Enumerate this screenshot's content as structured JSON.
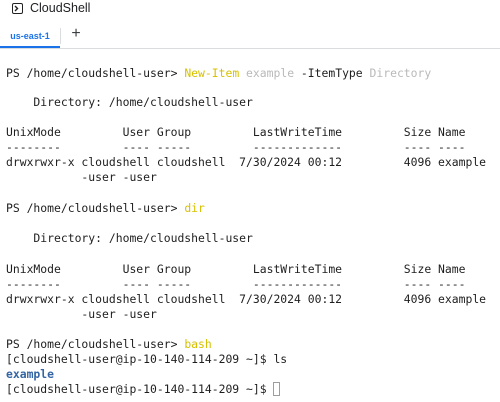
{
  "window": {
    "title": "CloudShell",
    "icon": "terminal-icon"
  },
  "tabs": [
    {
      "label": "us-east-1",
      "active": true
    }
  ],
  "add_tab_label": "+",
  "colors": {
    "accent": "#1a73e8",
    "command": "#d7c100",
    "argument_dim": "#b9b9b9",
    "directory": "#3465a4"
  },
  "terminal": {
    "prompt": "PS /home/cloudshell-user> ",
    "cmd1": {
      "name": "New-Item",
      "arg": "example",
      "param": "-ItemType",
      "value": "Directory"
    },
    "dir_header_1": "    Directory: /home/cloudshell-user",
    "col_headers_1": "UnixMode         User Group         LastWriteTime         Size Name",
    "col_rule_1": "--------         ---- -----         -------------         ---- ----",
    "row1_a": "drwxrwxr-x cloudshell cloudshell  7/30/2024 00:12         4096 example",
    "row1_b": "           -user -user",
    "cmd2": "dir",
    "dir_header_2": "    Directory: /home/cloudshell-user",
    "col_headers_2": "UnixMode         User Group         LastWriteTime         Size Name",
    "col_rule_2": "--------         ---- -----         -------------         ---- ----",
    "row2_a": "drwxrwxr-x cloudshell cloudshell  7/30/2024 00:12         4096 example",
    "row2_b": "           -user -user",
    "cmd3": "bash",
    "bash_prompt": "[cloudshell-user@ip-10-140-114-209 ~]$ ",
    "bash_cmd": "ls",
    "ls_output": "example"
  }
}
